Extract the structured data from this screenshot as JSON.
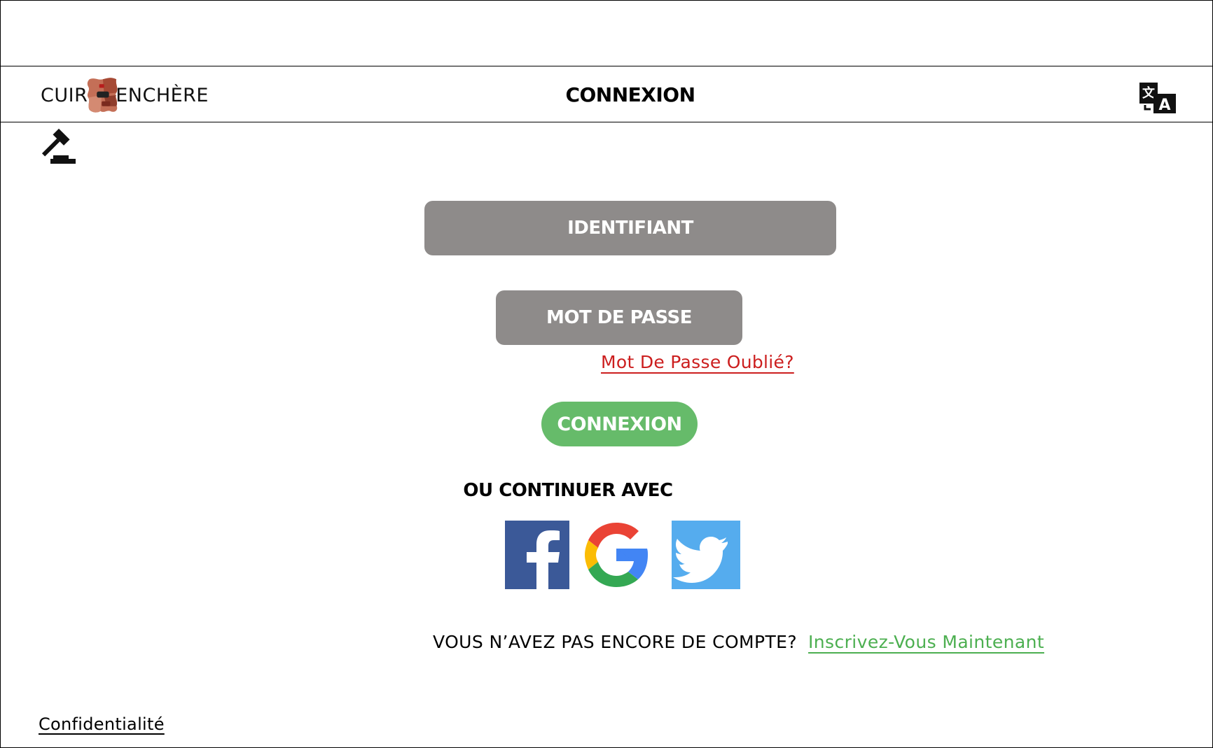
{
  "header": {
    "logo": {
      "left_text": "CUIR",
      "right_text": "ENCHÈRE"
    },
    "title": "CONNEXION",
    "translate_icon": "translate-icon"
  },
  "gavel_icon": "gavel-icon",
  "form": {
    "username_placeholder": "IDENTIFIANT",
    "password_placeholder": "MOT DE PASSE",
    "forgot_password": "Mot De Passe Oublié?",
    "submit_label": "CONNEXION"
  },
  "social": {
    "heading": "OU CONTINUER AVEC",
    "providers": [
      "facebook-icon",
      "google-icon",
      "twitter-icon"
    ]
  },
  "signup": {
    "prompt": "VOUS N’AVEZ PAS ENCORE DE COMPTE?",
    "link": "Inscrivez-Vous Maintenant"
  },
  "footer": {
    "privacy": "Confidentialité"
  },
  "colors": {
    "field_bg": "#8e8b8a",
    "primary_green": "#66bb6a",
    "link_green": "#4caf50",
    "link_red": "#cc1e1e",
    "facebook": "#3b5998",
    "twitter": "#55acee"
  }
}
